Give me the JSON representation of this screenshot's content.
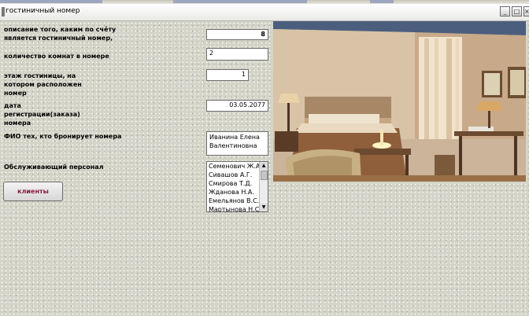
{
  "window": {
    "title": "гостиничный номер",
    "minimize_glyph": "_",
    "maximize_glyph": "□",
    "close_glyph": "×"
  },
  "labels": {
    "description": "описание того, каким по счёту является гостиничный номер,",
    "rooms_count": "количество комнат в номере",
    "floor": "этаж гостиницы, на котором расположен номер",
    "reg_date": "дата регистрации(заказа) номера",
    "booker_name": "ФИО тех, кто бронирует номера",
    "staff": "Обслуживающий персонал"
  },
  "fields": {
    "description_value": "8",
    "rooms_count_value": "2",
    "floor_value": "1",
    "reg_date_value": "03.05.2077",
    "booker_name_value": "Иванина Елена Валентиновна"
  },
  "staff_list": [
    "Семенович Ж.А.",
    "Сивашов А.Г.",
    "Смирова Т.Д.",
    "Жданова Н.А.",
    "Емельянов В.С.",
    "Мартынова Н.С."
  ],
  "buttons": {
    "clients": "клиенты"
  },
  "colors": {
    "button_text": "#8a1740",
    "form_bg": "#d4d4c8"
  }
}
